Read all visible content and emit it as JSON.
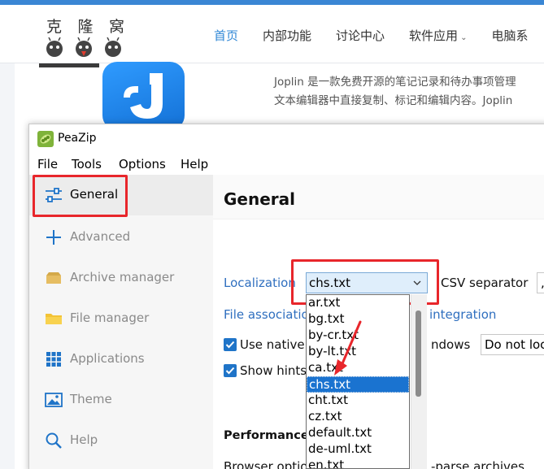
{
  "website": {
    "logo_chars": [
      "克",
      "隆",
      "窝"
    ],
    "nav": [
      {
        "label": "首页",
        "active": true
      },
      {
        "label": "内部功能"
      },
      {
        "label": "讨论中心"
      },
      {
        "label": "软件应用"
      },
      {
        "label": "电脑系"
      }
    ],
    "article_lines": [
      "Joplin 是一款免费开源的笔记记录和待办事项管理",
      "文本编辑器中直接复制、标记和编辑内容。Joplin"
    ]
  },
  "window": {
    "title": "PeaZip",
    "menu": [
      "File",
      "Tools",
      "Options",
      "Help"
    ]
  },
  "sidebar": {
    "items": [
      {
        "label": "General",
        "icon": "general-sliders-icon",
        "selected": true
      },
      {
        "label": "Advanced",
        "icon": "plus-icon"
      },
      {
        "label": "Archive manager",
        "icon": "archive-box-icon"
      },
      {
        "label": "File manager",
        "icon": "folder-icon"
      },
      {
        "label": "Applications",
        "icon": "grid-icon"
      },
      {
        "label": "Theme",
        "icon": "image-icon"
      },
      {
        "label": "Help",
        "icon": "magnifier-icon"
      }
    ]
  },
  "main": {
    "title": "General",
    "localization_link": "Localization",
    "localization_value": "chs.txt",
    "csv_label": "CSV separator",
    "csv_value": ",",
    "file_assoc_link": "File associatio",
    "integration_link": "integration",
    "use_native_label": "Use native",
    "windows_label": "ndows",
    "windows_value": "Do not loc",
    "show_hints_label": "Show hints",
    "performance_label": "Performance",
    "browser_label": "Browser optio",
    "preparse_label": "-parse archives"
  },
  "dropdown": {
    "options": [
      "ar.txt",
      "bg.txt",
      "by-cr.txt",
      "by-lt.txt",
      "ca.txt",
      "chs.txt",
      "cht.txt",
      "cz.txt",
      "default.txt",
      "de-uml.txt",
      "en.txt"
    ],
    "selected": "chs.txt"
  },
  "colors": {
    "accent": "#1f74c8",
    "link": "#2f6fbf",
    "highlight": "#e8262b",
    "selection": "#1a73d0"
  }
}
